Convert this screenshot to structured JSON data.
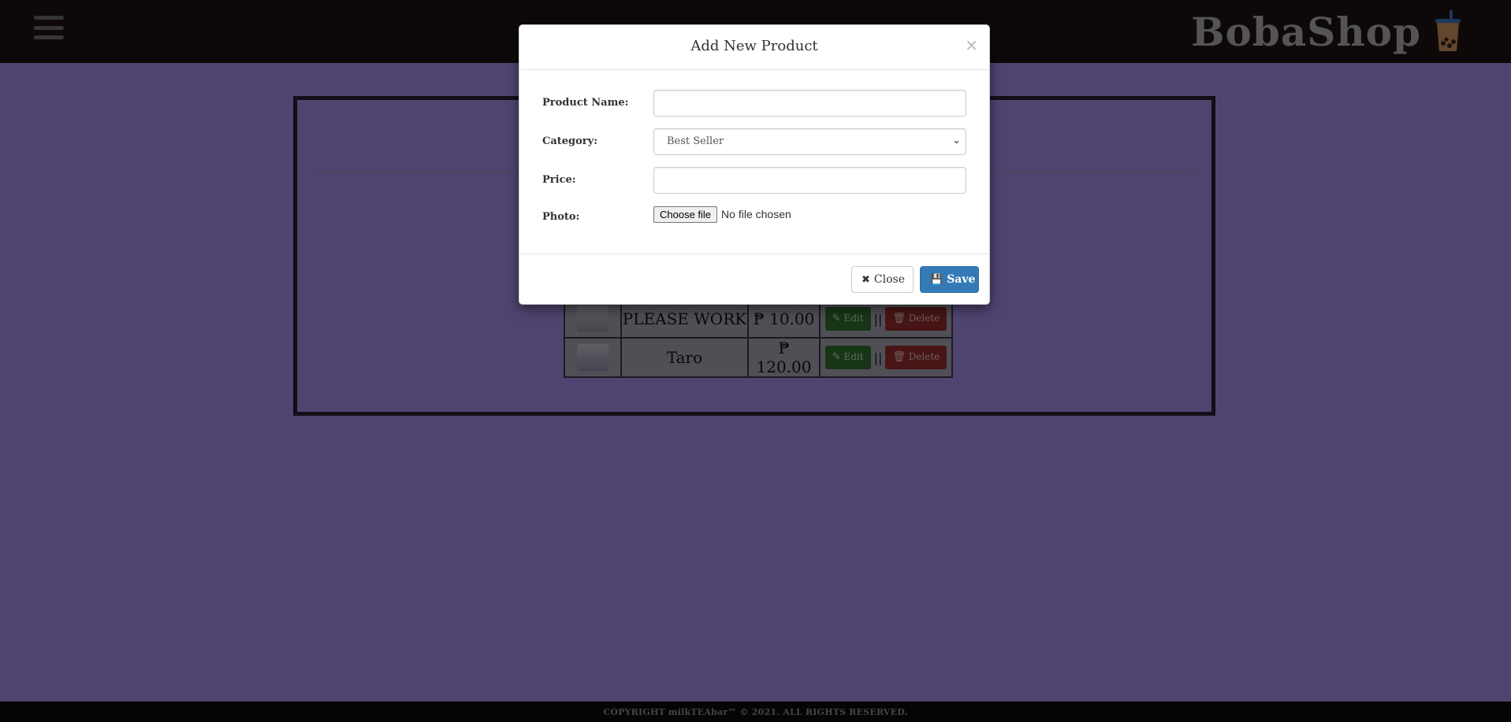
{
  "brand": {
    "name": "BobaShop",
    "icon": "bubble-tea-cup-icon"
  },
  "products": [
    {
      "name": "PLEASE WORK",
      "price": "₱ 10.00",
      "edit_label": "Edit",
      "delete_label": "Delete",
      "separator": "||"
    },
    {
      "name": "Taro",
      "price": "₱ 120.00",
      "edit_label": "Edit",
      "delete_label": "Delete",
      "separator": "||"
    }
  ],
  "modal": {
    "title": "Add New Product",
    "close_symbol": "×",
    "fields": {
      "product_name": {
        "label": "Product Name:",
        "value": ""
      },
      "category": {
        "label": "Category:",
        "value": "Best Seller"
      },
      "price": {
        "label": "Price:",
        "value": ""
      },
      "photo": {
        "label": "Photo:",
        "button": "Choose file",
        "status": "No file chosen"
      }
    },
    "buttons": {
      "close": "Close",
      "save": "Save"
    }
  },
  "footer": {
    "text": "COPYRIGHT milkTEAbar™ © 2021. ALL RIGHTS RESERVED."
  },
  "colors": {
    "page_bg": "#4f4470",
    "topbar": "#0e0908",
    "primary_button": "#337ab7",
    "edit_button": "#2d6d2d",
    "delete_button": "#8e2a2a"
  }
}
